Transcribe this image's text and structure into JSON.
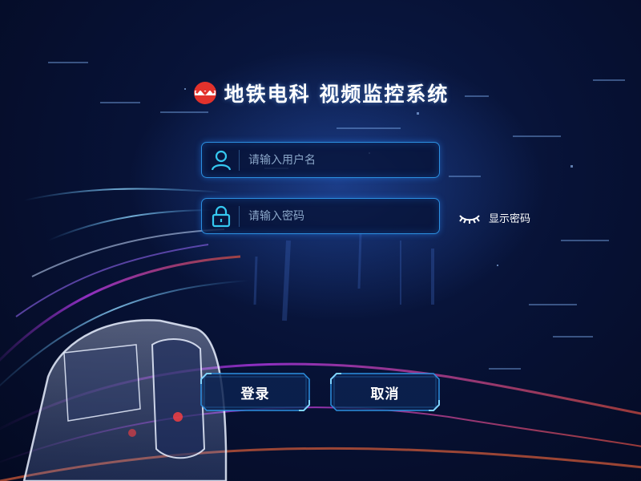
{
  "header": {
    "title": "地铁电科 视频监控系统",
    "logo_icon": "metro-logo-icon",
    "brand_color": "#e2322c"
  },
  "login_form": {
    "username": {
      "placeholder": "请输入用户名",
      "value": "",
      "icon": "user-icon"
    },
    "password": {
      "placeholder": "请输入密码",
      "value": "",
      "icon": "lock-icon"
    },
    "show_password": {
      "label": "显示密码",
      "icon": "eye-closed-icon"
    },
    "login_label": "登录",
    "cancel_label": "取消"
  },
  "colors": {
    "accent": "#2c8fe0",
    "icon_cyan": "#35c8f0",
    "background": "#071236"
  }
}
